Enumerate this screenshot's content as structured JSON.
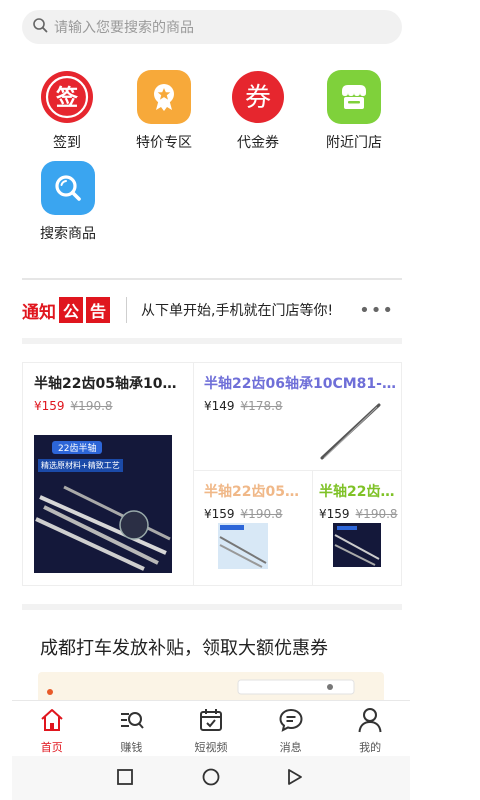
{
  "search": {
    "placeholder": "请输入您要搜索的商品"
  },
  "categories": [
    {
      "label": "签到",
      "glyph": "签",
      "icon": "sign-in-icon"
    },
    {
      "label": "特价专区",
      "icon": "ribbon-badge-icon"
    },
    {
      "label": "代金券",
      "glyph": "券",
      "icon": "coupon-icon"
    },
    {
      "label": "附近门店",
      "icon": "store-icon"
    },
    {
      "label": "搜索商品",
      "icon": "magnifier-icon"
    }
  ],
  "notice": {
    "prefix": "通知",
    "box1": "公",
    "box2": "告",
    "text": "从下单开始,手机就在门店等你!",
    "more": "•••"
  },
  "products": [
    {
      "title": "半轴22齿05轴承10C...",
      "price": "¥159",
      "old": "¥190.8",
      "title_color": "#222222",
      "price_color": "#e0161e"
    },
    {
      "title": "半轴22齿06轴承10CM81-8...",
      "price": "¥149",
      "old": "¥178.8",
      "title_color": "#6f6fd8",
      "price_color": "#222222"
    },
    {
      "title": "半轴22齿05轴...",
      "price": "¥159",
      "old": "¥190.8",
      "title_color": "#f0b888",
      "price_color": "#222222"
    },
    {
      "title": "半轴22齿0...",
      "price": "¥159",
      "old": "¥190.8",
      "title_color": "#7fc227",
      "price_color": "#222222"
    }
  ],
  "product_image_text": {
    "badge": "22齿半轴",
    "line": "精选原材料+精致工艺"
  },
  "promo": {
    "title": "成都打车发放补贴，领取大额优惠券"
  },
  "tabs": [
    {
      "label": "首页",
      "icon": "home-icon",
      "active": true
    },
    {
      "label": "赚钱",
      "icon": "earn-search-icon"
    },
    {
      "label": "短视频",
      "icon": "video-calendar-icon"
    },
    {
      "label": "消息",
      "icon": "message-icon"
    },
    {
      "label": "我的",
      "icon": "profile-icon"
    }
  ],
  "colors": {
    "accent": "#e0161e"
  }
}
